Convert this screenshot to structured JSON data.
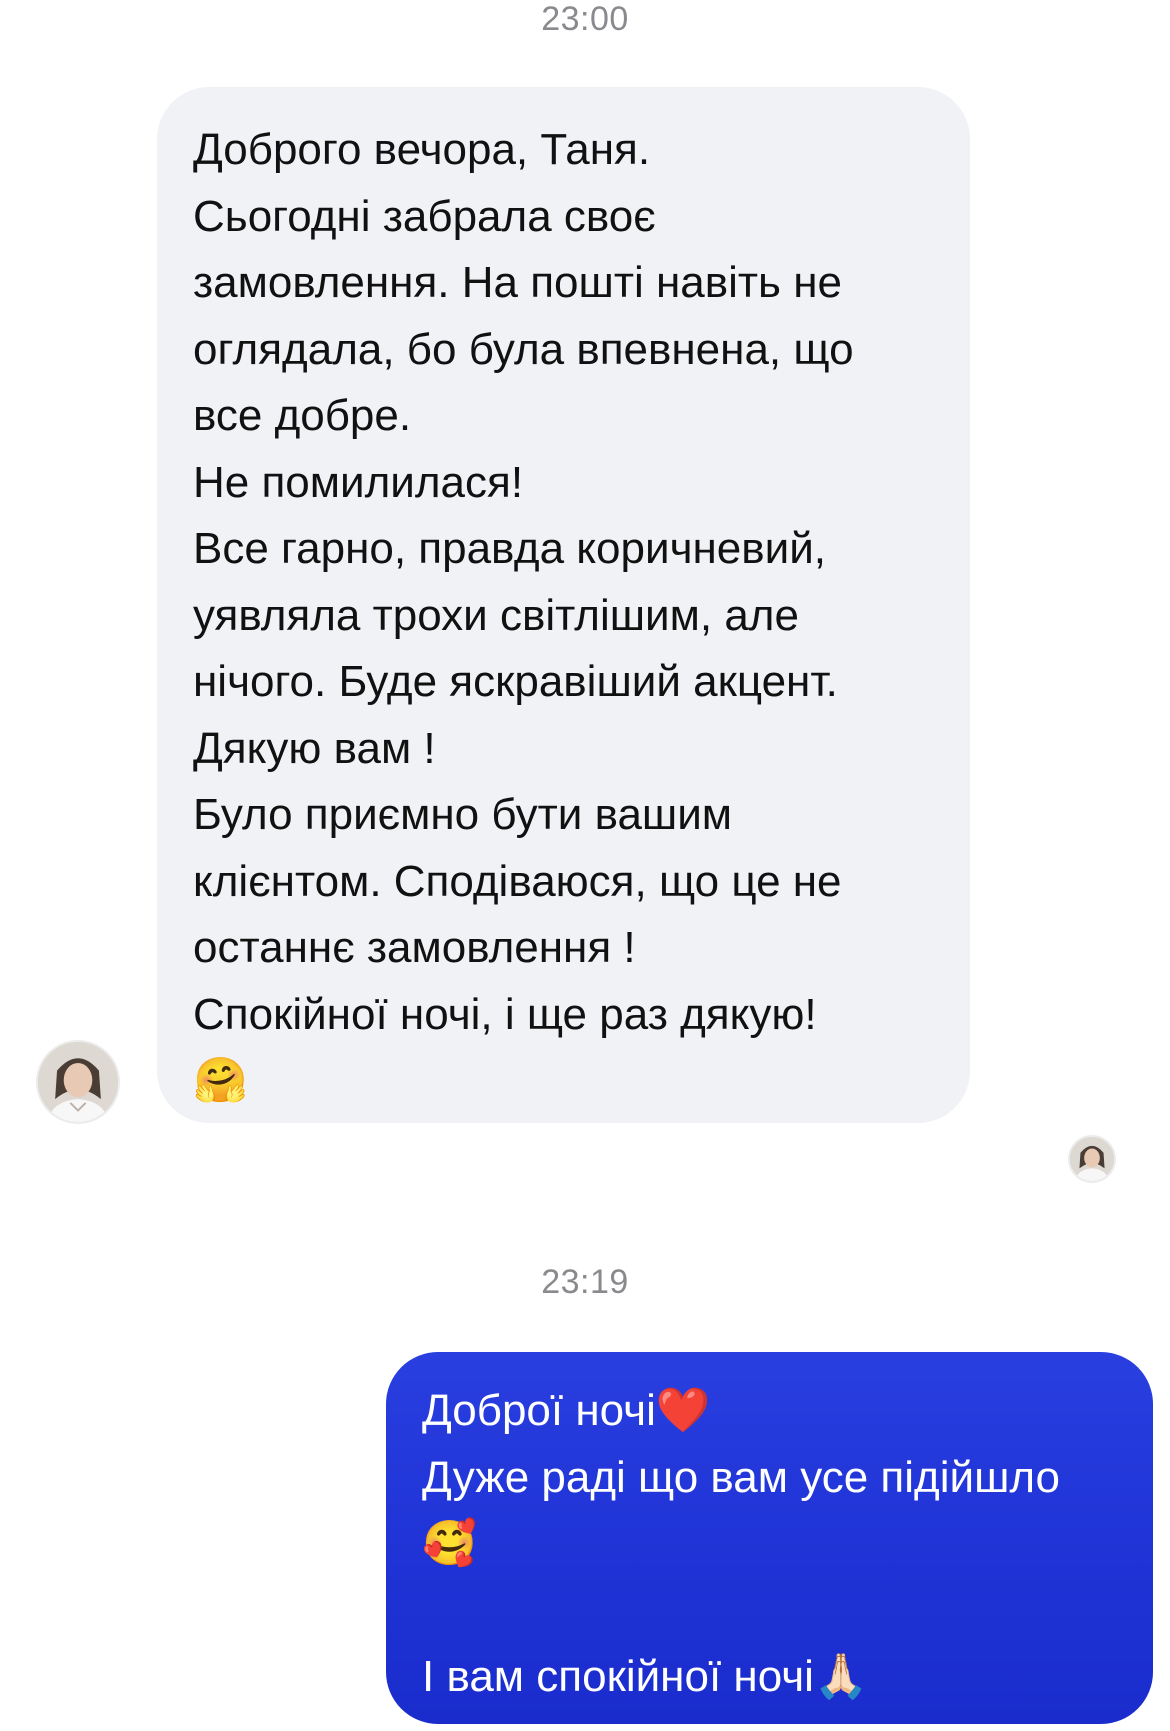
{
  "conversation": {
    "timestamps": [
      "23:00",
      "23:19"
    ],
    "incoming": {
      "text": "Доброго вечора, Таня.\nСьогодні забрала своє\nзамовлення. На пошті навіть не\nоглядала, бо була впевнена, що\nвсе добре.\nНе помилилася!\nВсе гарно, правда коричневий,\nуявляла трохи світлішим, але\nнічого. Буде яскравіший акцент.\nДякую вам !\nБуло приємно бути вашим\nклієнтом. Сподіваюся, що це не\nостаннє замовлення !\nСпокійної ночі, і ще раз дякую!\n🤗"
    },
    "outgoing": {
      "text": "Доброї ночі❤️\nДуже раді що вам усе підійшло\n🥰\n\nІ вам спокійної ночі🙏🏻"
    }
  },
  "colors": {
    "incoming_bubble": "#f1f2f6",
    "outgoing_bubble": "#1f33d6",
    "timestamp": "#8a8a8e"
  },
  "icons": {
    "sender_avatar": "contact-avatar-icon",
    "read_receipt_avatar": "read-receipt-avatar-icon"
  }
}
